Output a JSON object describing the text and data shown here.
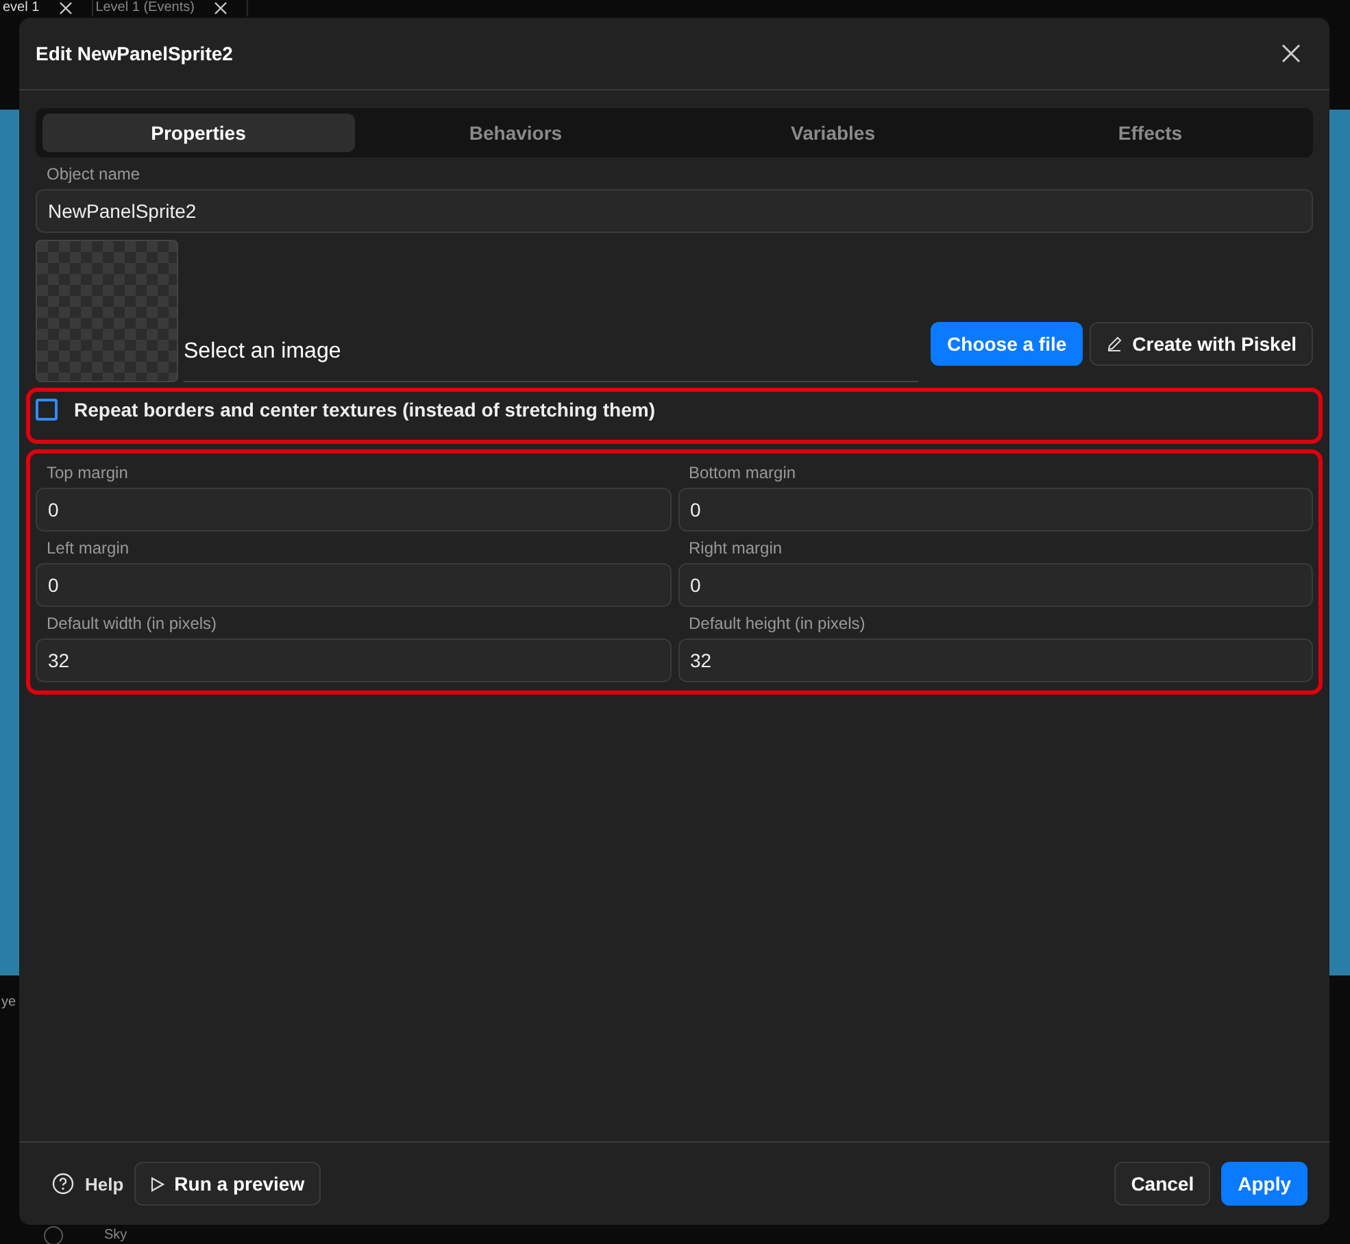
{
  "background": {
    "tabs": [
      {
        "label": "evel 1",
        "selected": true
      },
      {
        "label": "Level 1 (Events)",
        "selected": false
      }
    ],
    "panel_label": "ye",
    "layer": "Sky"
  },
  "dialog": {
    "title": "Edit NewPanelSprite2",
    "tabs": [
      {
        "label": "Properties",
        "selected": true
      },
      {
        "label": "Behaviors",
        "selected": false
      },
      {
        "label": "Variables",
        "selected": false
      },
      {
        "label": "Effects",
        "selected": false
      }
    ],
    "object_name": {
      "label": "Object name",
      "value": "NewPanelSprite2"
    },
    "image": {
      "label": "Select an image",
      "choose_button": "Choose a file",
      "piskel_button": "Create with Piskel"
    },
    "repeat": {
      "label": "Repeat borders and center textures (instead of stretching them)",
      "checked": false
    },
    "fields": [
      {
        "label": "Top margin",
        "value": "0"
      },
      {
        "label": "Bottom margin",
        "value": "0"
      },
      {
        "label": "Left margin",
        "value": "0"
      },
      {
        "label": "Right margin",
        "value": "0"
      },
      {
        "label": "Default width (in pixels)",
        "value": "32"
      },
      {
        "label": "Default height (in pixels)",
        "value": "32"
      }
    ],
    "footer": {
      "help": "Help",
      "preview": "Run a preview",
      "cancel": "Cancel",
      "apply": "Apply"
    }
  }
}
